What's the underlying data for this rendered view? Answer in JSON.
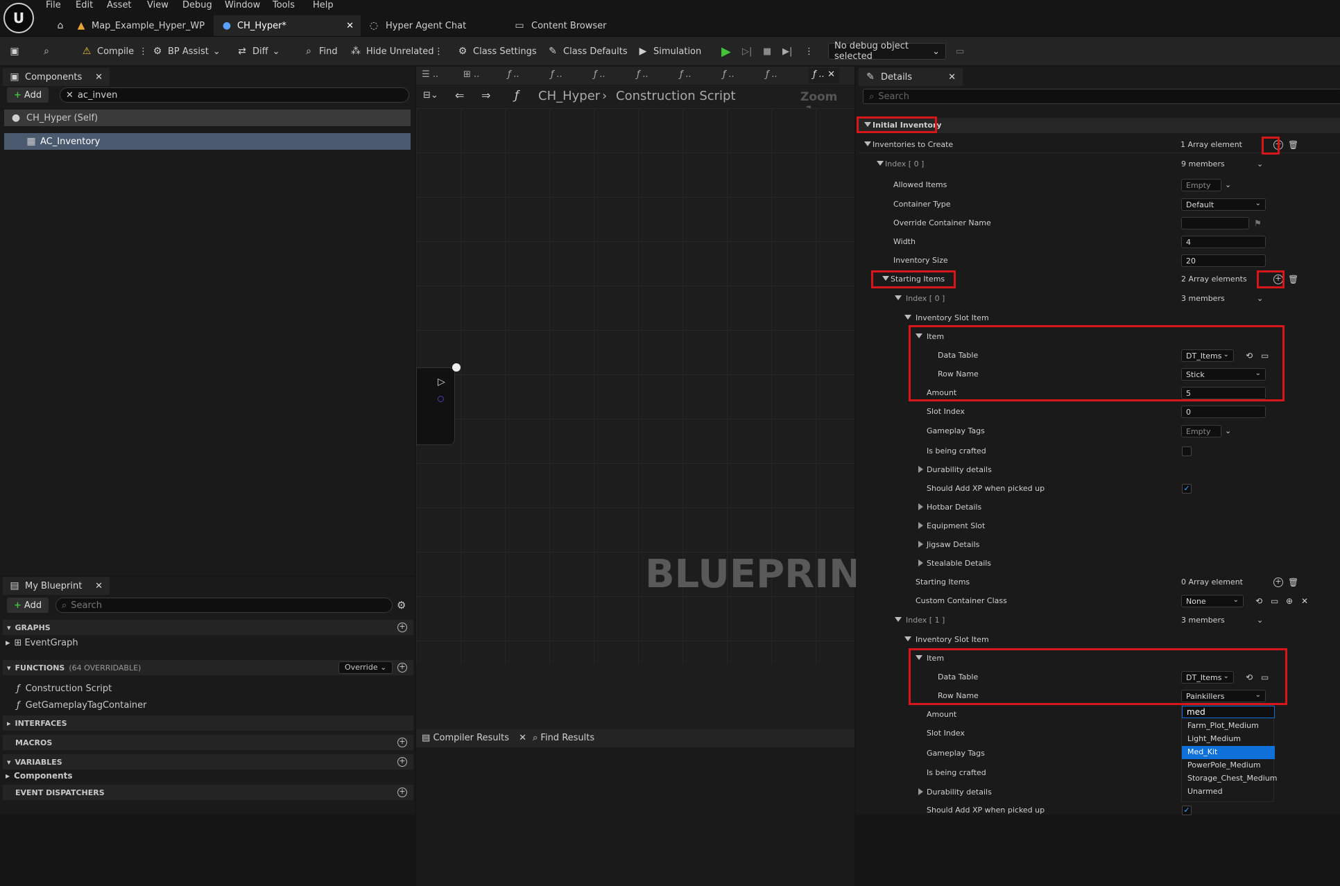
{
  "menu": [
    "File",
    "Edit",
    "Asset",
    "View",
    "Debug",
    "Window",
    "Tools",
    "Help"
  ],
  "tabs": [
    {
      "label": "Map_Example_Hyper_WP"
    },
    {
      "label": "CH_Hyper*"
    },
    {
      "label": "Hyper Agent Chat"
    },
    {
      "label": "Content Browser"
    }
  ],
  "toolbar": {
    "compile": "Compile",
    "bp_assist": "BP Assist",
    "diff": "Diff",
    "find": "Find",
    "hide_unrelated": "Hide Unrelated",
    "class_settings": "Class Settings",
    "class_defaults": "Class Defaults",
    "simulation": "Simulation",
    "debug_object": "No debug object selected"
  },
  "components": {
    "title": "Components",
    "add": "Add",
    "search_value": "ac_inven",
    "self_item": "CH_Hyper (Self)",
    "child_item": "AC_Inventory"
  },
  "my_blueprint": {
    "title": "My Blueprint",
    "add": "Add",
    "search_placeholder": "Search",
    "graphs": "GRAPHS",
    "event_graph": "EventGraph",
    "functions": "FUNCTIONS",
    "functions_count": "(64 OVERRIDABLE)",
    "override": "Override",
    "construction_script": "Construction Script",
    "get_tag": "GetGameplayTagContainer",
    "interfaces": "INTERFACES",
    "macros": "MACROS",
    "variables": "VARIABLES",
    "components_cat": "Components",
    "event_dispatchers": "EVENT DISPATCHERS"
  },
  "graph": {
    "breadcrumb_root": "CH_Hyper",
    "breadcrumb_leaf": "Construction Script",
    "zoom": "Zoom -1",
    "watermark": "BLUEPRINT",
    "compiler_results": "Compiler Results",
    "find_results": "Find Results"
  },
  "details": {
    "title": "Details",
    "search_placeholder": "Search",
    "category": "Initial Inventory",
    "inventories_to_create": "Inventories to Create",
    "inventories_value": "1 Array element",
    "index0": "Index [ 0 ]",
    "index0_members": "9 members",
    "allowed_items": "Allowed Items",
    "empty": "Empty",
    "container_type": "Container Type",
    "container_type_value": "Default",
    "override_container_name": "Override Container Name",
    "width": "Width",
    "width_value": "4",
    "inventory_size": "Inventory Size",
    "inventory_size_value": "20",
    "starting_items": "Starting Items",
    "starting_items_value": "2 Array elements",
    "si_index0": "Index [ 0 ]",
    "si_index0_members": "3 members",
    "inventory_slot_item": "Inventory Slot Item",
    "item": "Item",
    "data_table": "Data Table",
    "data_table_value": "DT_Items",
    "row_name": "Row Name",
    "row_name_value_0": "Stick",
    "amount": "Amount",
    "amount_value_0": "5",
    "slot_index": "Slot Index",
    "slot_index_value": "0",
    "gameplay_tags": "Gameplay Tags",
    "is_being_crafted": "Is being crafted",
    "durability_details": "Durability details",
    "should_add_xp": "Should Add XP when picked up",
    "hotbar_details": "Hotbar Details",
    "equipment_slot": "Equipment Slot",
    "jigsaw_details": "Jigsaw Details",
    "stealable_details": "Stealable Details",
    "starting_items_inner": "Starting Items",
    "starting_items_inner_value": "0 Array element",
    "custom_container_class": "Custom Container Class",
    "custom_container_value": "None",
    "si_index1": "Index [ 1 ]",
    "si_index1_members": "3 members",
    "row_name_value_1": "Painkillers",
    "dropdown_search": "med",
    "dropdown_options": [
      "Farm_Plot_Medium",
      "Light_Medium",
      "Med_Kit",
      "PowerPole_Medium",
      "Storage_Chest_Medium",
      "Unarmed"
    ]
  }
}
